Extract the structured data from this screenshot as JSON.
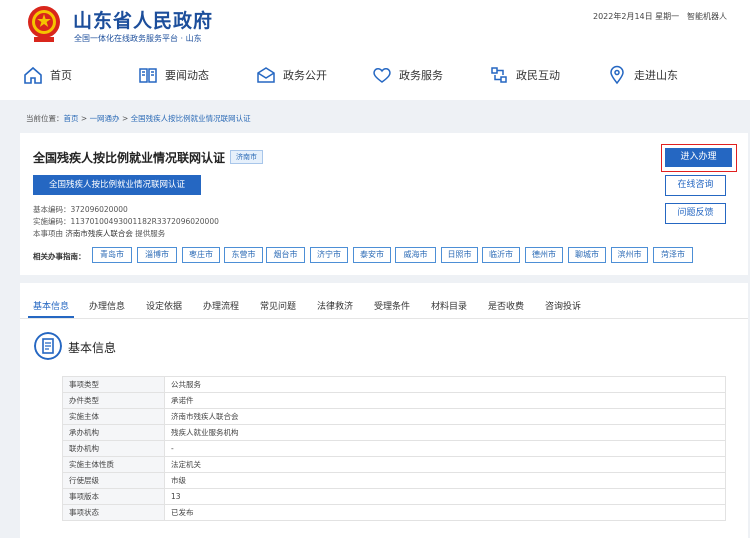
{
  "header": {
    "site_title": "山东省人民政府",
    "site_subtitle": "全国一体化在线政务服务平台 · 山东",
    "date": "2022年2月14日 星期一",
    "robot": "智能机器人"
  },
  "nav": [
    {
      "label": "首页",
      "icon": "home-icon"
    },
    {
      "label": "要闻动态",
      "icon": "book-icon"
    },
    {
      "label": "政务公开",
      "icon": "mailbox-icon"
    },
    {
      "label": "政务服务",
      "icon": "heart-icon"
    },
    {
      "label": "政民互动",
      "icon": "exchange-icon"
    },
    {
      "label": "走进山东",
      "icon": "location-icon"
    }
  ],
  "breadcrumb": {
    "prefix": "当前位置：",
    "items": [
      "首页",
      "一网通办",
      "全国残疾人按比例就业情况联网认证"
    ],
    "sep": " > "
  },
  "service": {
    "title": "全国残疾人按比例就业情况联网认证",
    "city_tag": "济南市",
    "name_button": "全国残疾人按比例就业情况联网认证",
    "basic_code": "基本编码：372096020000",
    "impl_code": "实施编码：11370100493001182R3372096020000",
    "provider_prefix": "本事项由",
    "provider_name": "济南市残疾人联合会",
    "provider_suffix": "提供服务",
    "enter_button": "进入办理",
    "consult_button": "在线咨询",
    "feedback_button": "问题反馈",
    "related_label": "相关办事指南：",
    "related_cities": [
      "青岛市",
      "淄博市",
      "枣庄市",
      "东营市",
      "烟台市",
      "济宁市",
      "泰安市",
      "威海市",
      "日照市",
      "临沂市",
      "德州市",
      "聊城市",
      "滨州市",
      "菏泽市"
    ]
  },
  "tabs": [
    "基本信息",
    "办理信息",
    "设定依据",
    "办理流程",
    "常见问题",
    "法律救济",
    "受理条件",
    "材料目录",
    "是否收费",
    "咨询投诉"
  ],
  "section_title": "基本信息",
  "info_rows": [
    {
      "key": "事项类型",
      "value": "公共服务"
    },
    {
      "key": "办件类型",
      "value": "承诺件"
    },
    {
      "key": "实施主体",
      "value": "济南市残疾人联合会"
    },
    {
      "key": "承办机构",
      "value": "残疾人就业服务机构"
    },
    {
      "key": "联办机构",
      "value": "-"
    },
    {
      "key": "实施主体性质",
      "value": "法定机关"
    },
    {
      "key": "行使层级",
      "value": "市级"
    },
    {
      "key": "事项版本",
      "value": "13"
    },
    {
      "key": "事项状态",
      "value": "已发布"
    }
  ],
  "colors": {
    "brand_blue": "#2567c2",
    "highlight_red": "#e02020",
    "title_blue": "#1c4e9b"
  }
}
